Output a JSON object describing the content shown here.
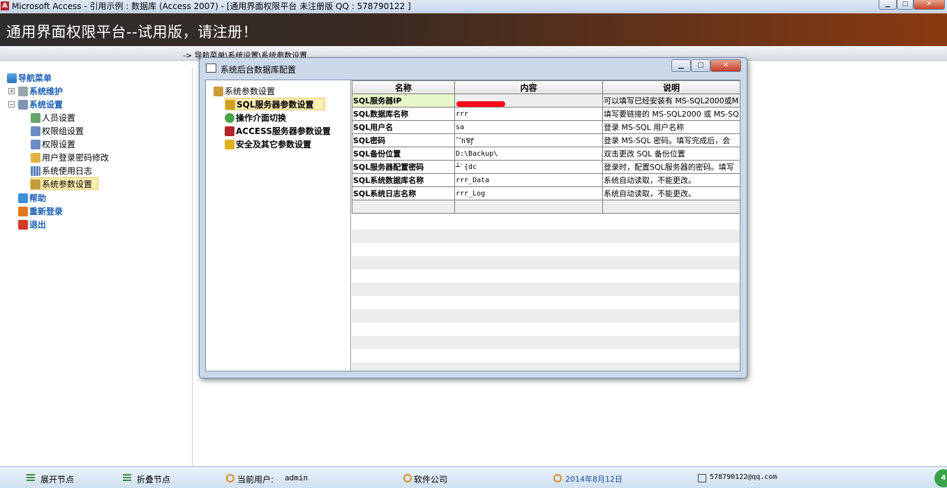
{
  "window": {
    "title": "Microsoft Access - 引用示例 : 数据库 (Access 2007) - [通用界面权限平台  未注册版 QQ : 578790122 ]",
    "app_icon": "A",
    "min": "▁",
    "max": "□",
    "close": "✕"
  },
  "banner": {
    "text": "通用界面权限平台--试用版，请注册！"
  },
  "breadcrumb": {
    "text": "-> 导航菜单\\系统设置\\系统参数设置"
  },
  "nav": {
    "root": "导航菜单",
    "items": [
      {
        "label": "系统维护"
      },
      {
        "label": "系统设置"
      },
      {
        "label": "人员设置"
      },
      {
        "label": "权限组设置"
      },
      {
        "label": "权限设置"
      },
      {
        "label": "用户登录密码修改"
      },
      {
        "label": "系统使用日志"
      },
      {
        "label": "系统参数设置"
      },
      {
        "label": "帮助"
      },
      {
        "label": "重新登录"
      },
      {
        "label": "退出"
      }
    ],
    "expand_plus": "+",
    "expand_minus": "−"
  },
  "footer": {
    "expand": "展开节点",
    "collapse": "折叠节点",
    "user_label": "当前用户:",
    "user": "admin",
    "company": "软件公司",
    "date": "2014年8月12日",
    "email": "578790122@qq.com",
    "badge": "4"
  },
  "dialog": {
    "title": "系统后台数据库配置",
    "min": "▁",
    "max": "□",
    "close": "✕",
    "tree": {
      "root": "系统参数设置",
      "items": [
        "SQL服务器参数设置",
        "操作介面切换",
        "ACCESS服务器参数设置",
        "安全及其它参数设置"
      ]
    },
    "grid": {
      "headers": [
        "名称",
        "内容",
        "说明"
      ],
      "rows": [
        {
          "name": "SQL服务器IP",
          "value": "",
          "desc": "可以填写已经安装有 MS-SQL2000或M"
        },
        {
          "name": "SQL数据库名称",
          "value": "rrr",
          "desc": "填写要链接的 MS-SQL2000 或 MS-SQ"
        },
        {
          "name": "SQL用户名",
          "value": "sa",
          "desc": "登录 MS-SQL 用户名称"
        },
        {
          "name": "SQL密码",
          "value": "꒙h⅋ꝭ",
          "desc": "登录 MS-SQL 密码。填写完成后，会"
        },
        {
          "name": "SQL备份位置",
          "value": "D:\\Backup\\",
          "desc": "双击更改 SQL 备份位置"
        },
        {
          "name": "SQL服务器配置密码",
          "value": "┴`{dc",
          "desc": "登录时，配置SQL服务器的密码。填写"
        },
        {
          "name": "SQL系统数据库名称",
          "value": "rrr_Data",
          "desc": "系统自动读取，不能更改。"
        },
        {
          "name": "SQL系统日志名称",
          "value": "rrr_Log",
          "desc": "系统自动读取，不能更改。"
        }
      ]
    }
  },
  "colors": {
    "banner_right": "#8a3a10",
    "selection": "#fdeeb0",
    "redaction": "#ff0a1a"
  }
}
